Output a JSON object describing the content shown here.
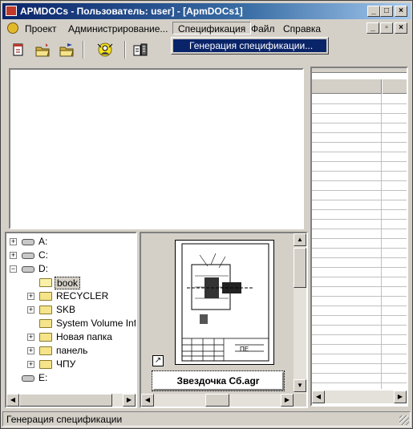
{
  "window": {
    "title": "APMDOCs - Пользователь: user] - [ApmDOCs1]",
    "caption_buttons": {
      "minimize": "_",
      "maximize": "□",
      "close": "×"
    },
    "mdi_buttons": {
      "minimize": "_",
      "restore": "▫",
      "close": "×"
    }
  },
  "menubar": {
    "items": [
      "Проект",
      "Администрирование...",
      "Спецификация",
      "Файл",
      "Справка"
    ],
    "active": "Спецификация"
  },
  "dropdown": {
    "items": [
      "Генерация спецификации..."
    ]
  },
  "toolbar": {
    "buttons": [
      "new-document-icon",
      "open-folder-icon",
      "open-folder-star-icon",
      "search-user-icon",
      "print-icon"
    ]
  },
  "tree": {
    "items": [
      {
        "label": "A:",
        "icon": "floppy-drive-icon",
        "expander": "+"
      },
      {
        "label": "C:",
        "icon": "hard-drive-icon",
        "expander": "+"
      },
      {
        "label": "D:",
        "icon": "hard-drive-icon",
        "expander": "−"
      },
      {
        "label": "book",
        "icon": "folder-open-icon",
        "expander": "",
        "selected": true
      },
      {
        "label": "RECYCLER",
        "icon": "folder-icon",
        "expander": "+"
      },
      {
        "label": "SKB",
        "icon": "folder-icon",
        "expander": "+"
      },
      {
        "label": "System Volume Info",
        "icon": "folder-icon",
        "expander": ""
      },
      {
        "label": "Новая папка",
        "icon": "folder-icon",
        "expander": "+"
      },
      {
        "label": "панель",
        "icon": "folder-icon",
        "expander": "+"
      },
      {
        "label": "ЧПУ",
        "icon": "folder-icon",
        "expander": "+"
      },
      {
        "label": "E:",
        "icon": "network-drive-icon",
        "expander": ""
      }
    ]
  },
  "preview": {
    "file_name": "Звездочка Сб.agr",
    "shortcut_icon": "shortcut-arrow-icon"
  },
  "statusbar": {
    "text": "Генерация спецификации"
  }
}
